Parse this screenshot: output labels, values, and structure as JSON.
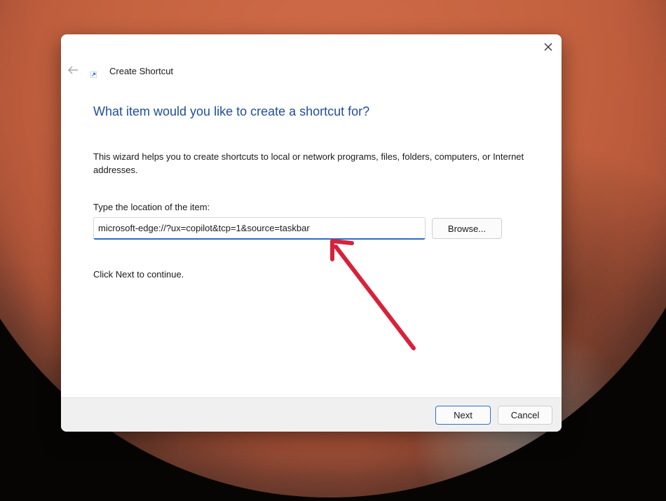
{
  "dialog": {
    "title": "Create Shortcut",
    "heading": "What item would you like to create a shortcut for?",
    "description": "This wizard helps you to create shortcuts to local or network programs, files, folders, computers, or Internet addresses.",
    "location_label": "Type the location of the item:",
    "location_value": "microsoft-edge://?ux=copilot&tcp=1&source=taskbar",
    "browse_label": "Browse...",
    "continue_text": "Click Next to continue.",
    "next_label": "Next",
    "cancel_label": "Cancel"
  },
  "icons": {
    "close": "close-icon",
    "back": "back-arrow-icon",
    "app": "shortcut-icon",
    "annotation": "red-arrow-icon"
  },
  "colors": {
    "heading": "#1f4e9a",
    "accent": "#2a6dc8",
    "annotation_arrow": "#d8213a",
    "footer": "#f0f0f0"
  }
}
